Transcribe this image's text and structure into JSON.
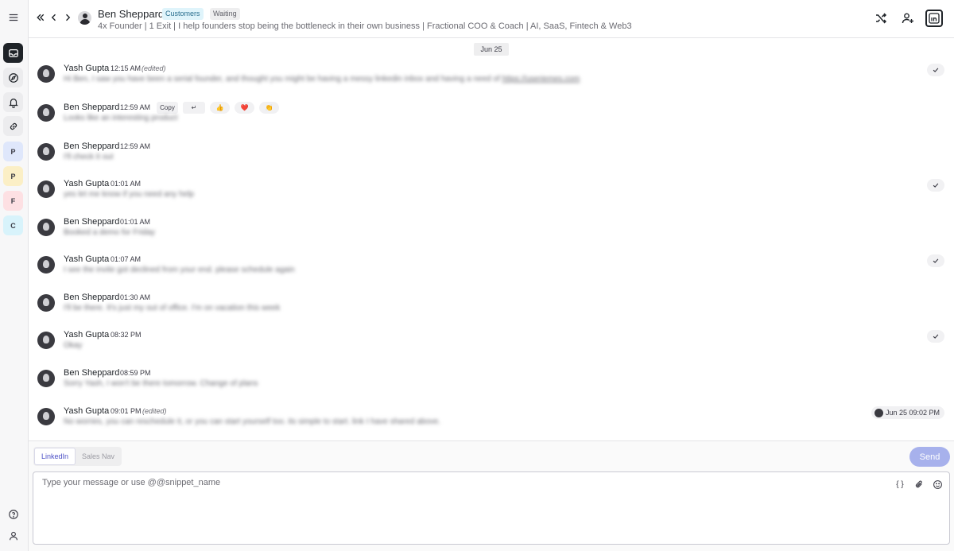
{
  "rail": {
    "letters": [
      "P",
      "P",
      "F",
      "C"
    ],
    "letter_colors": [
      "#dfe7fb",
      "#fbefc6",
      "#fde0e3",
      "#d8f3fb"
    ]
  },
  "header": {
    "name": "Ben Sheppard",
    "tags": [
      "Customers",
      "Waiting"
    ],
    "subtitle": "4x Founder | 1 Exit | I help founders stop being the bottleneck in their own business | Fractional COO & Coach | AI, SaaS, Fintech & Web3"
  },
  "chat": {
    "date": "Jun 25",
    "messages": [
      {
        "name": "Yash Gupta",
        "time": "12:15 AM",
        "edited": "(edited)",
        "text": "Hi Ben, I saw you have been a serial founder, and thought you might be having a messy linkedin inbox and having a need of ",
        "link": "https://useriemes.com"
      },
      {
        "name": "Ben Sheppard",
        "time": "12:59 AM",
        "text": "Looks like an interesting product"
      },
      {
        "name": "Ben Sheppard",
        "time": "12:59 AM",
        "text": "I'll check it out"
      },
      {
        "name": "Yash Gupta",
        "time": "01:01 AM",
        "text": "yes let me know if you need any help"
      },
      {
        "name": "Ben Sheppard",
        "time": "01:01 AM",
        "text": "Booked a demo for Friday"
      },
      {
        "name": "Yash Gupta",
        "time": "01:07 AM",
        "text": "I see the invite got declined from your end. please schedule again"
      },
      {
        "name": "Ben Sheppard",
        "time": "01:30 AM",
        "text": "I'll be there. It's just my out of office. I'm on vacation this week"
      },
      {
        "name": "Yash Gupta",
        "time": "08:32 PM",
        "text": "Okay"
      },
      {
        "name": "Ben Sheppard",
        "time": "08:59 PM",
        "text": "Sorry Yash, I won't be there tomorrow. Change of plans"
      },
      {
        "name": "Yash Gupta",
        "time": "09:01 PM",
        "edited": "(edited)",
        "text": "No worries, you can reschedule it, or you can start yourself too. its simple to start. link I have shared above."
      }
    ],
    "reactions": [
      "Copy",
      "↵",
      "👍",
      "❤️",
      "👏"
    ],
    "seen_label": "Jun 25 09:02 PM"
  },
  "composer": {
    "tabs": [
      "LinkedIn",
      "Sales Nav"
    ],
    "send_label": "Send",
    "placeholder": "Type your message or use @@snippet_name",
    "snippet_icon": "{ }"
  }
}
